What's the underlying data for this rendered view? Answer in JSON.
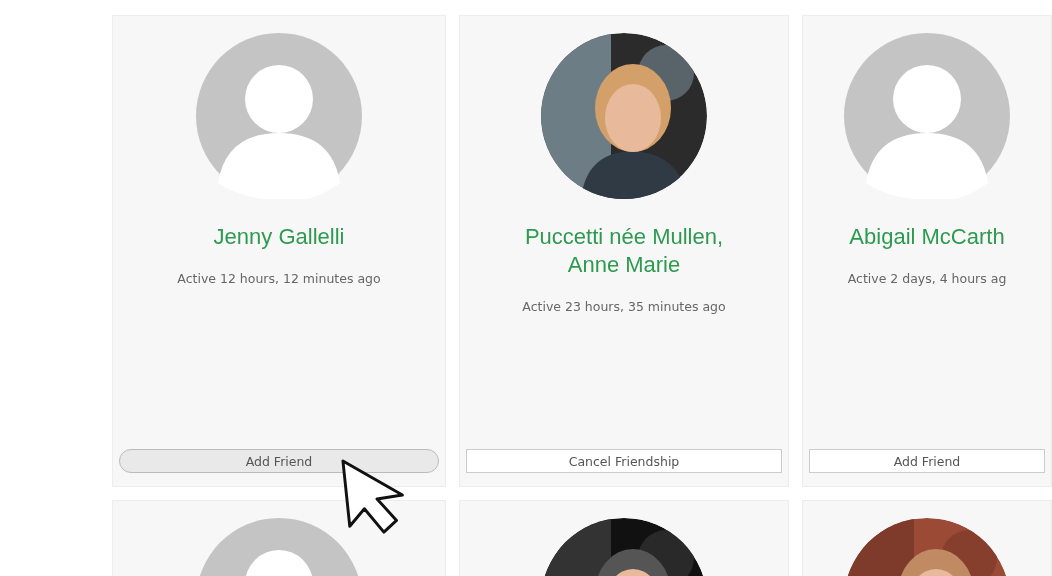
{
  "members": [
    {
      "avatar": {
        "kind": "placeholder"
      },
      "name": "Jenny Gallelli",
      "active": "Active 12 hours, 12 minutes ago",
      "button": {
        "label": "Add Friend",
        "hovered": true
      }
    },
    {
      "avatar": {
        "kind": "picture"
      },
      "name": "Puccetti née Mullen, Anne Marie",
      "active": "Active 23 hours, 35 minutes ago",
      "button": {
        "label": "Cancel Friendship",
        "hovered": false
      }
    },
    {
      "avatar": {
        "kind": "placeholder"
      },
      "name": "Abigail McCarth",
      "active": "Active 2 days, 4 hours ag",
      "button": {
        "label": "Add Friend",
        "hovered": false
      }
    },
    {
      "avatar": {
        "kind": "placeholder"
      }
    },
    {
      "avatar": {
        "kind": "picture"
      }
    },
    {
      "avatar": {
        "kind": "picture"
      }
    }
  ],
  "cursor": true
}
